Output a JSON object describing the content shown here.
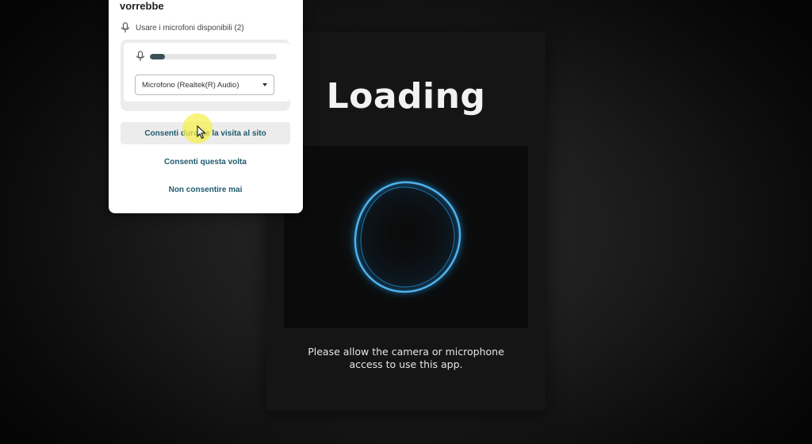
{
  "app": {
    "title": "Loading",
    "message_line1": "Please allow the camera or microphone",
    "message_line2": "access to use this app.",
    "ring_color": "#3a9fd8"
  },
  "permission_popup": {
    "heading": "vorrebbe",
    "request_label": "Usare i microfoni disponibili (2)",
    "mic_level": 0.12,
    "selected_microphone": "Microfono (Realtek(R) Audio)",
    "buttons": {
      "allow_while_visiting": "Consenti durante la visita al sito",
      "allow_this_time": "Consenti questa volta",
      "never_allow": "Non consentire mai"
    },
    "accent_color": "#1f5a6e"
  }
}
